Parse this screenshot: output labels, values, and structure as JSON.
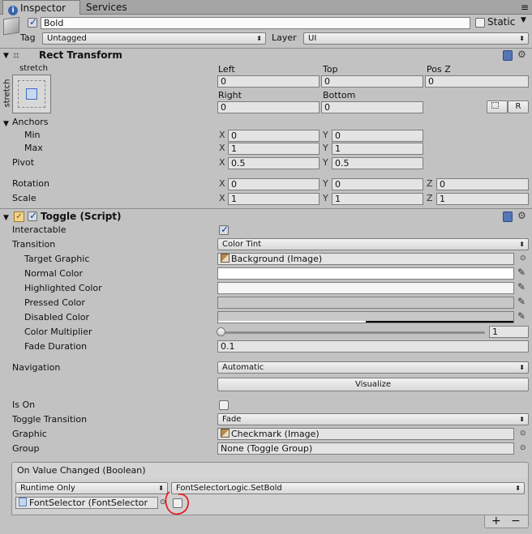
{
  "tabs": [
    {
      "label": "Inspector"
    },
    {
      "label": "Services"
    }
  ],
  "object": {
    "name": "Bold",
    "static_label": "Static",
    "tag_label": "Tag",
    "tag_value": "Untagged",
    "layer_label": "Layer",
    "layer_value": "UI"
  },
  "rect_transform": {
    "title": "Rect Transform",
    "anchor_preset_top": "stretch",
    "anchor_preset_side": "stretch",
    "left_label": "Left",
    "left_value": "0",
    "top_label": "Top",
    "top_value": "0",
    "posz_label": "Pos Z",
    "posz_value": "0",
    "right_label": "Right",
    "right_value": "0",
    "bottom_label": "Bottom",
    "bottom_value": "0",
    "r_button": "R",
    "anchors_label": "Anchors",
    "min_label": "Min",
    "min_x": "0",
    "min_y": "0",
    "max_label": "Max",
    "max_x": "1",
    "max_y": "1",
    "pivot_label": "Pivot",
    "pivot_x": "0.5",
    "pivot_y": "0.5",
    "rotation_label": "Rotation",
    "rot_x": "0",
    "rot_y": "0",
    "rot_z": "0",
    "scale_label": "Scale",
    "scale_x": "1",
    "scale_y": "1",
    "scale_z": "1",
    "x": "X",
    "y": "Y",
    "z": "Z"
  },
  "toggle": {
    "title": "Toggle (Script)",
    "interactable_label": "Interactable",
    "transition_label": "Transition",
    "transition_value": "Color Tint",
    "target_graphic_label": "Target Graphic",
    "target_graphic_value": "Background (Image)",
    "normal_color_label": "Normal Color",
    "highlighted_color_label": "Highlighted Color",
    "pressed_color_label": "Pressed Color",
    "disabled_color_label": "Disabled Color",
    "color_multiplier_label": "Color Multiplier",
    "color_multiplier_value": "1",
    "fade_duration_label": "Fade Duration",
    "fade_duration_value": "0.1",
    "navigation_label": "Navigation",
    "navigation_value": "Automatic",
    "visualize_label": "Visualize",
    "is_on_label": "Is On",
    "toggle_transition_label": "Toggle Transition",
    "toggle_transition_value": "Fade",
    "graphic_label": "Graphic",
    "graphic_value": "Checkmark (Image)",
    "group_label": "Group",
    "group_value": "None (Toggle Group)"
  },
  "event": {
    "title": "On Value Changed (Boolean)",
    "runtime_value": "Runtime Only",
    "function_value": "FontSelectorLogic.SetBold",
    "object_value": "FontSelector (FontSelector",
    "add": "+",
    "remove": "−"
  },
  "colors": {
    "normal": "#ffffff",
    "highlighted": "#f5f5f5",
    "pressed": "#c8c8c8",
    "disabled": "#c8c8c8",
    "annotation": "#e8141b"
  }
}
